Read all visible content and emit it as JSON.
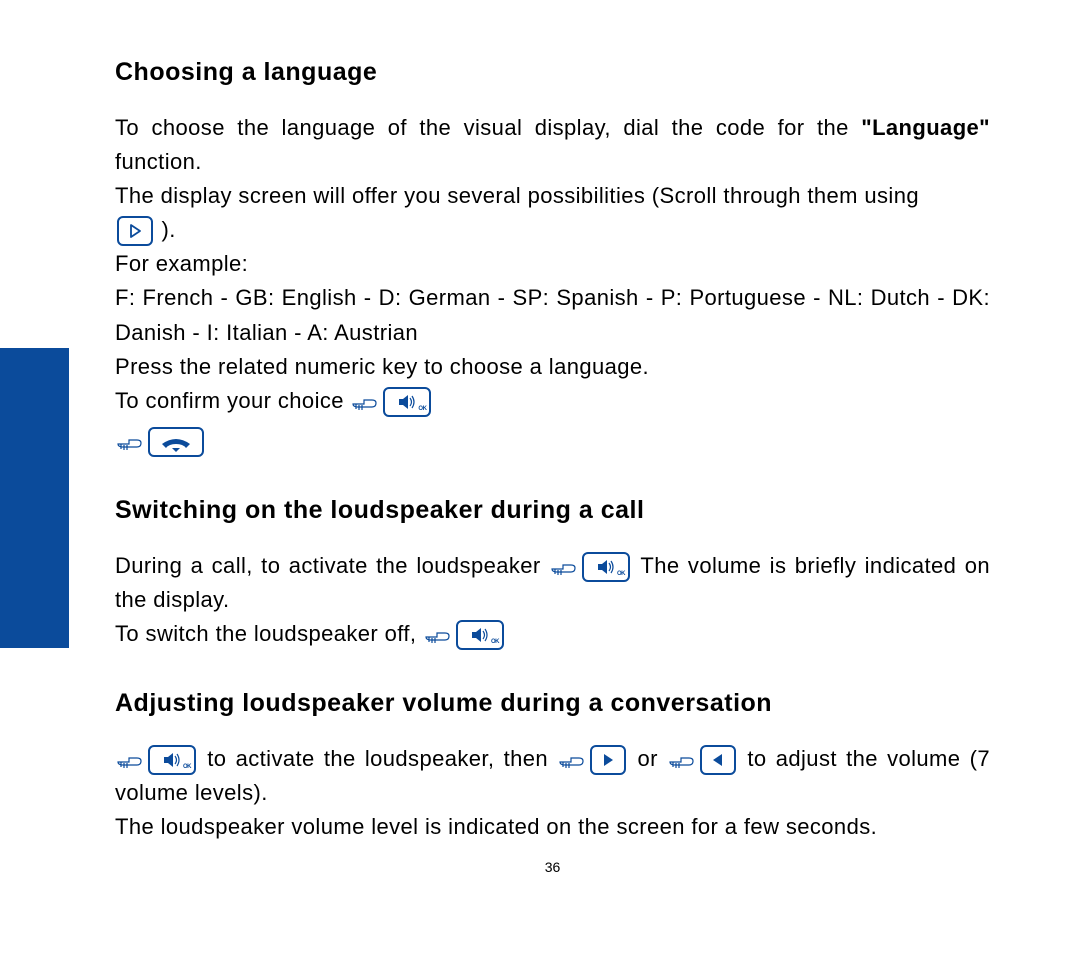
{
  "pageNumber": "36",
  "s1": {
    "heading": "Choosing a language",
    "p1a": "To choose the language of the visual display, dial the code for the ",
    "p1b": "\"Language\"",
    "p1c": " function.",
    "p2": "The display screen will offer you several possibilities (Scroll through them using",
    "p2end": " ).",
    "p3": "For example:",
    "p4": "F: French - GB: English - D: German - SP: Spanish - P: Portuguese - NL: Dutch - DK: Danish - I: Italian - A: Austrian",
    "p5": "Press the related numeric key to choose a language.",
    "p6": "To confirm your choice "
  },
  "s2": {
    "heading": "Switching on the loudspeaker during a call",
    "p1a": "During a call, to activate the loudspeaker ",
    "p1b": " The volume is briefly indicated on the display.",
    "p2": "To switch the loudspeaker off, "
  },
  "s3": {
    "heading": "Adjusting loudspeaker volume during a conversation",
    "p1a": " to activate the loudspeaker, then ",
    "p1b": " or ",
    "p1c": " to adjust the volume (7 volume levels).",
    "p2": "The loudspeaker volume level is indicated on the screen for a few seconds."
  }
}
